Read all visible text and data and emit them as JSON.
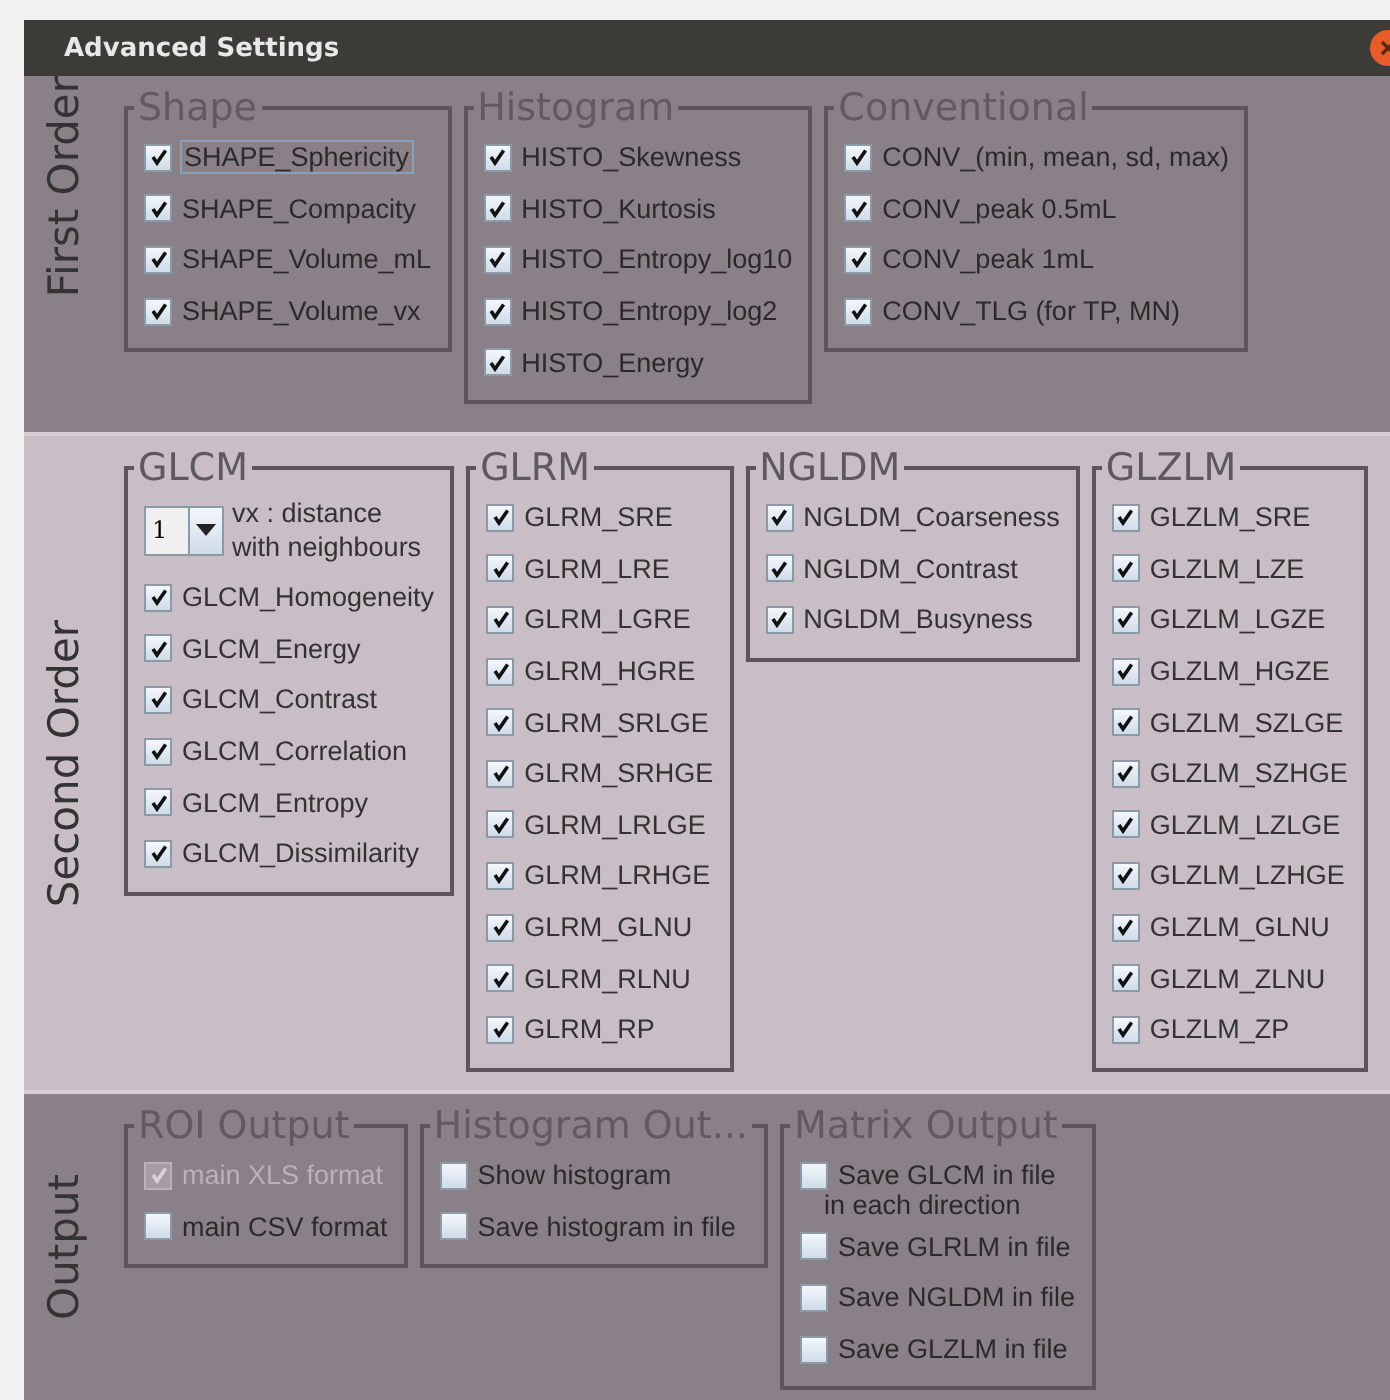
{
  "window": {
    "title": "Advanced Settings"
  },
  "sections": [
    {
      "title": "First Order",
      "kind": "dark",
      "groups": [
        {
          "title": "Shape",
          "items": [
            {
              "label": "SHAPE_Sphericity",
              "checked": true,
              "focused": true
            },
            {
              "label": "SHAPE_Compacity",
              "checked": true,
              "focused": false
            },
            {
              "label": "SHAPE_Volume_mL",
              "checked": true,
              "focused": false
            },
            {
              "label": "SHAPE_Volume_vx",
              "checked": true,
              "focused": false
            }
          ]
        },
        {
          "title": "Histogram",
          "items": [
            {
              "label": "HISTO_Skewness",
              "checked": true
            },
            {
              "label": "HISTO_Kurtosis",
              "checked": true
            },
            {
              "label": "HISTO_Entropy_log10",
              "checked": true
            },
            {
              "label": "HISTO_Entropy_log2",
              "checked": true
            },
            {
              "label": "HISTO_Energy",
              "checked": true
            }
          ]
        },
        {
          "title": "Conventional",
          "items": [
            {
              "label": "CONV_(min, mean, sd, max)",
              "checked": true
            },
            {
              "label": "CONV_peak 0.5mL",
              "checked": true
            },
            {
              "label": "CONV_peak 1mL",
              "checked": true
            },
            {
              "label": "CONV_TLG (for TP, MN)",
              "checked": true
            }
          ]
        }
      ]
    },
    {
      "title": "Second Order",
      "kind": "light",
      "groups": [
        {
          "title": "GLCM",
          "spinner": {
            "value": "1",
            "label_lines": [
              "vx : distance",
              "with neighbours"
            ]
          },
          "items": [
            {
              "label": "GLCM_Homogeneity",
              "checked": true
            },
            {
              "label": "GLCM_Energy",
              "checked": true
            },
            {
              "label": "GLCM_Contrast",
              "checked": true
            },
            {
              "label": "GLCM_Correlation",
              "checked": true
            },
            {
              "label": "GLCM_Entropy",
              "checked": true
            },
            {
              "label": "GLCM_Dissimilarity",
              "checked": true
            }
          ]
        },
        {
          "title": "GLRM",
          "items": [
            {
              "label": "GLRM_SRE",
              "checked": true
            },
            {
              "label": "GLRM_LRE",
              "checked": true
            },
            {
              "label": "GLRM_LGRE",
              "checked": true
            },
            {
              "label": "GLRM_HGRE",
              "checked": true
            },
            {
              "label": "GLRM_SRLGE",
              "checked": true
            },
            {
              "label": "GLRM_SRHGE",
              "checked": true
            },
            {
              "label": "GLRM_LRLGE",
              "checked": true
            },
            {
              "label": "GLRM_LRHGE",
              "checked": true
            },
            {
              "label": "GLRM_GLNU",
              "checked": true
            },
            {
              "label": "GLRM_RLNU",
              "checked": true
            },
            {
              "label": "GLRM_RP",
              "checked": true
            }
          ]
        },
        {
          "title": "NGLDM",
          "items": [
            {
              "label": "NGLDM_Coarseness",
              "checked": true
            },
            {
              "label": "NGLDM_Contrast",
              "checked": true
            },
            {
              "label": "NGLDM_Busyness",
              "checked": true
            }
          ]
        },
        {
          "title": "GLZLM",
          "items": [
            {
              "label": "GLZLM_SRE",
              "checked": true
            },
            {
              "label": "GLZLM_LZE",
              "checked": true
            },
            {
              "label": "GLZLM_LGZE",
              "checked": true
            },
            {
              "label": "GLZLM_HGZE",
              "checked": true
            },
            {
              "label": "GLZLM_SZLGE",
              "checked": true
            },
            {
              "label": "GLZLM_SZHGE",
              "checked": true
            },
            {
              "label": "GLZLM_LZLGE",
              "checked": true
            },
            {
              "label": "GLZLM_LZHGE",
              "checked": true
            },
            {
              "label": "GLZLM_GLNU",
              "checked": true
            },
            {
              "label": "GLZLM_ZLNU",
              "checked": true
            },
            {
              "label": "GLZLM_ZP",
              "checked": true
            }
          ]
        }
      ]
    },
    {
      "title": "Output",
      "kind": "dark",
      "groups": [
        {
          "title": "ROI Output",
          "items": [
            {
              "label": "main XLS format",
              "checked": true,
              "disabled": true
            },
            {
              "label": "main CSV format",
              "checked": false,
              "disabled": false
            }
          ]
        },
        {
          "title": "Histogram Out...",
          "items": [
            {
              "label": "Show histogram",
              "checked": false
            },
            {
              "label": "Save histogram in file",
              "checked": false
            }
          ]
        },
        {
          "title": "Matrix Output",
          "items": [
            {
              "label": "Save GLCM in file",
              "note": "in each direction",
              "checked": false
            },
            {
              "label": "Save GLRLM in file",
              "checked": false
            },
            {
              "label": "Save NGLDM in file",
              "checked": false
            },
            {
              "label": "Save GLZLM in file",
              "checked": false
            }
          ]
        }
      ]
    }
  ]
}
